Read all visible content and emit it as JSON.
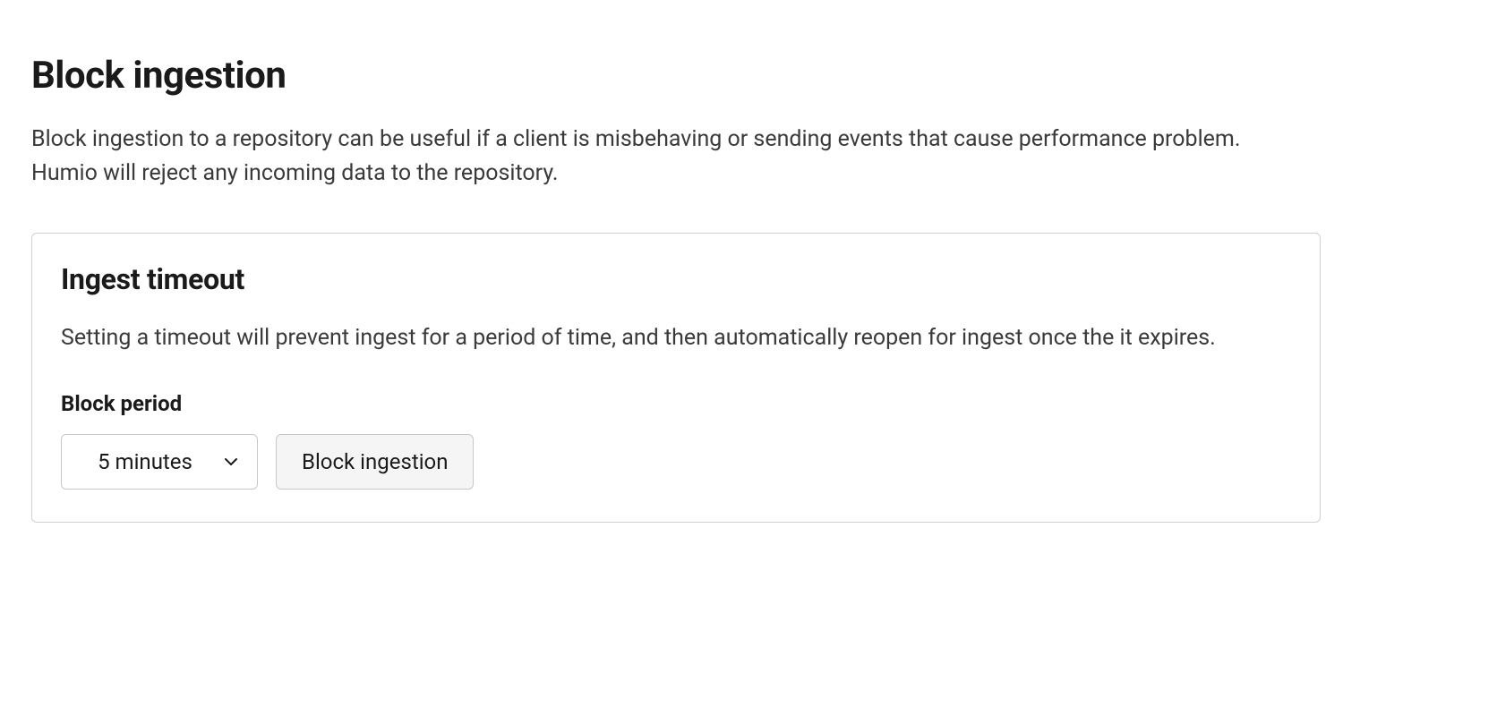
{
  "page": {
    "title": "Block ingestion",
    "description": "Block ingestion to a repository can be useful if a client is misbehaving or sending events that cause performance problem. Humio will reject any incoming data to the repository."
  },
  "card": {
    "title": "Ingest timeout",
    "description": "Setting a timeout will prevent ingest for a period of time, and then automatically reopen for ingest once the it expires.",
    "block_period_label": "Block period",
    "select_value": "5 minutes",
    "button_label": "Block ingestion"
  }
}
